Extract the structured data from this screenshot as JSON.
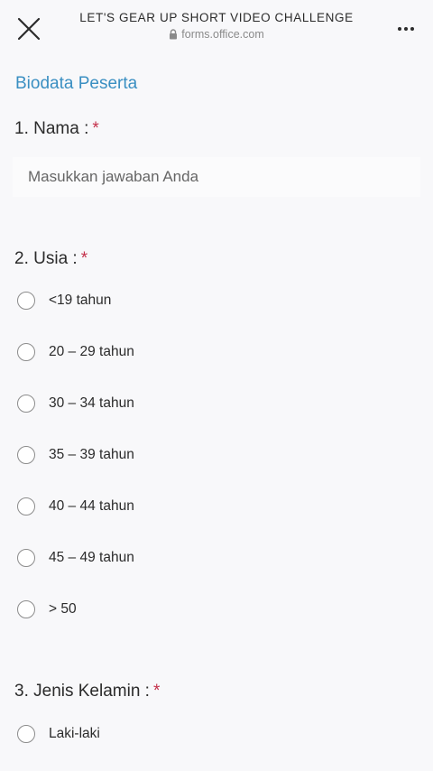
{
  "header": {
    "title": "LET'S GEAR UP SHORT VIDEO CHALLENGE",
    "url": "forms.office.com",
    "close_icon": "close-icon",
    "lock_icon": "lock-icon",
    "more_icon": "more-horizontal-icon"
  },
  "section": {
    "title": "Biodata Peserta",
    "accent_color": "#3a8fc2",
    "required_color": "#c4314b"
  },
  "questions": {
    "q1": {
      "label": "1. Nama :",
      "required_mark": "*",
      "placeholder": "Masukkan jawaban Anda"
    },
    "q2": {
      "label": "2. Usia :",
      "required_mark": "*",
      "options": [
        "<19 tahun",
        "20 – 29 tahun",
        "30 – 34 tahun",
        "35 – 39 tahun",
        "40 – 44 tahun",
        "45 – 49 tahun",
        "> 50"
      ]
    },
    "q3": {
      "label": "3. Jenis Kelamin :",
      "required_mark": "*",
      "options": [
        "Laki-laki"
      ]
    }
  }
}
